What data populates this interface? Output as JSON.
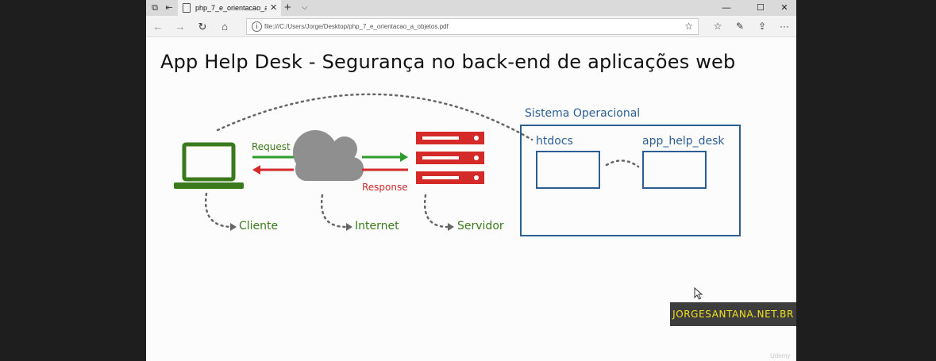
{
  "window": {
    "tab_title": "php_7_e_orientacao_a_objetos",
    "tab_close": "✕",
    "new_tab": "+",
    "tab_list": "⌵",
    "minimize": "—",
    "maximize": "☐",
    "close": "✕"
  },
  "navigation": {
    "back": "←",
    "forward": "→",
    "refresh": "↻",
    "home": "⌂",
    "url": "file:///C:/Users/Jorge/Desktop/php_7_e_orientacao_a_objetos.pdf",
    "info": "i",
    "favorite": "☆"
  },
  "toolbar": {
    "favorites_bar": "☆",
    "notes": "✎",
    "share": "⇪",
    "more": "···"
  },
  "slide": {
    "title": "App Help Desk - Segurança no back-end de aplicações web",
    "request_label": "Request",
    "response_label": "Response",
    "cliente_label": "Cliente",
    "internet_label": "Internet",
    "servidor_label": "Servidor",
    "os_label": "Sistema Operacional",
    "htdocs_label": "htdocs",
    "app_label": "app_help_desk"
  },
  "colors": {
    "green": "#3a7a1c",
    "arrow_green": "#2d9c2d",
    "red": "#d42a2a",
    "gray": "#8f8f8f",
    "blue": "#2c5e94"
  },
  "watermark": "JORGESANTANA.NET.BR",
  "udemy": "Udemy"
}
